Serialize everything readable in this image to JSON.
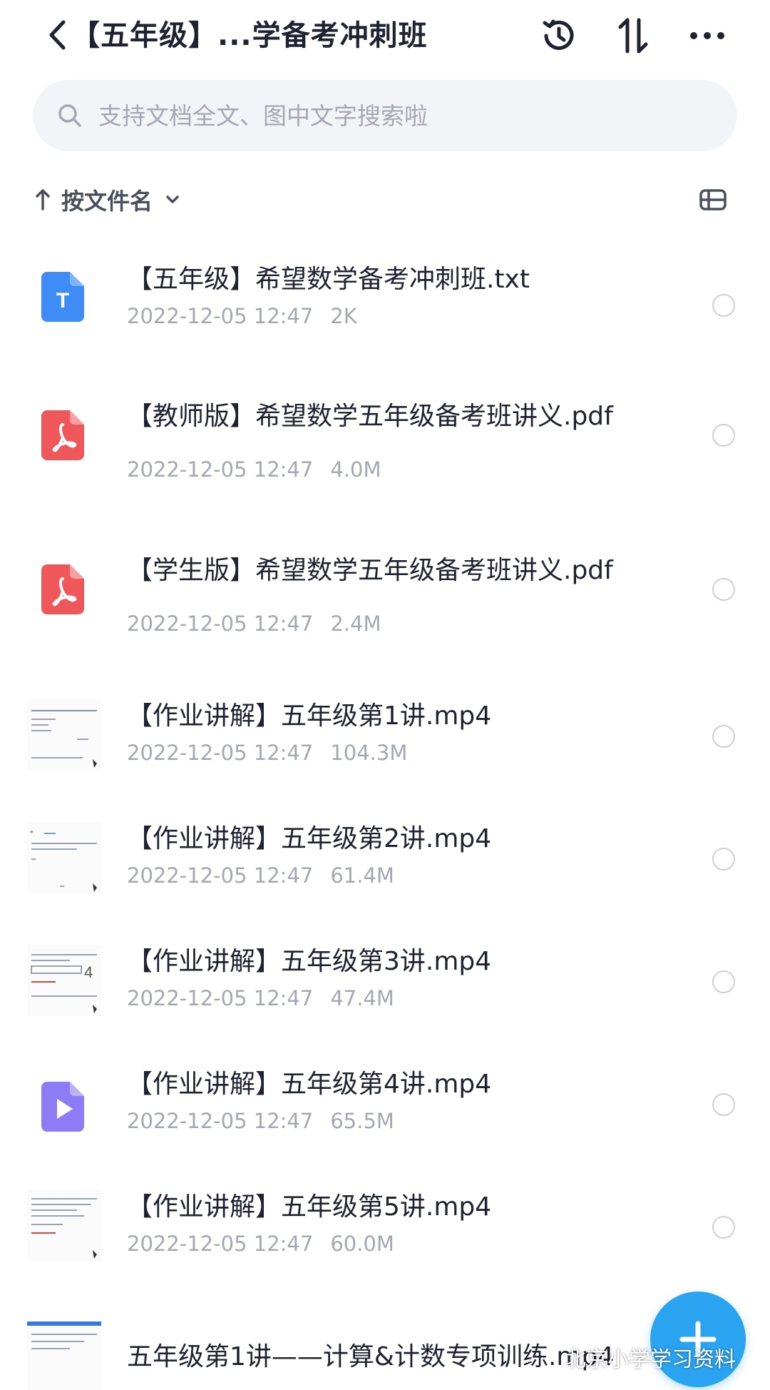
{
  "header": {
    "title": "【五年级】...学备考冲刺班",
    "icons": {
      "back": "chevron-left-icon",
      "history": "history-icon",
      "sort": "sort-icon",
      "more": "more-icon"
    }
  },
  "search": {
    "placeholder": "支持文档全文、图中文字搜索啦"
  },
  "sortbar": {
    "label": "按文件名"
  },
  "files": [
    {
      "name": "【五年级】希望数学备考冲刺班.txt",
      "date": "2022-12-05 12:47",
      "size": "2K",
      "icon": "txt-file-icon"
    },
    {
      "name": "【教师版】希望数学五年级备考班讲义.pdf",
      "date": "2022-12-05 12:47",
      "size": "4.0M",
      "icon": "pdf-file-icon"
    },
    {
      "name": "【学生版】希望数学五年级备考班讲义.pdf",
      "date": "2022-12-05 12:47",
      "size": "2.4M",
      "icon": "pdf-file-icon"
    },
    {
      "name": "【作业讲解】五年级第1讲.mp4",
      "date": "2022-12-05 12:47",
      "size": "104.3M",
      "icon": "video-thumbnail"
    },
    {
      "name": "【作业讲解】五年级第2讲.mp4",
      "date": "2022-12-05 12:47",
      "size": "61.4M",
      "icon": "video-thumbnail"
    },
    {
      "name": "【作业讲解】五年级第3讲.mp4",
      "date": "2022-12-05 12:47",
      "size": "47.4M",
      "icon": "video-thumbnail"
    },
    {
      "name": "【作业讲解】五年级第4讲.mp4",
      "date": "2022-12-05 12:47",
      "size": "65.5M",
      "icon": "video-file-icon"
    },
    {
      "name": "【作业讲解】五年级第5讲.mp4",
      "date": "2022-12-05 12:47",
      "size": "60.0M",
      "icon": "video-thumbnail"
    },
    {
      "name": "五年级第1讲——计算&计数专项训练.mp4",
      "icon": "video-thumbnail"
    }
  ],
  "fab": {
    "icon": "plus-icon"
  },
  "watermark": "北京小学学习资料",
  "colors": {
    "accent": "#2aa3f0",
    "txt": "#3f8cf6",
    "pdf": "#f0575b",
    "video": "#8e7cf6",
    "meta": "#a4a8b3"
  }
}
